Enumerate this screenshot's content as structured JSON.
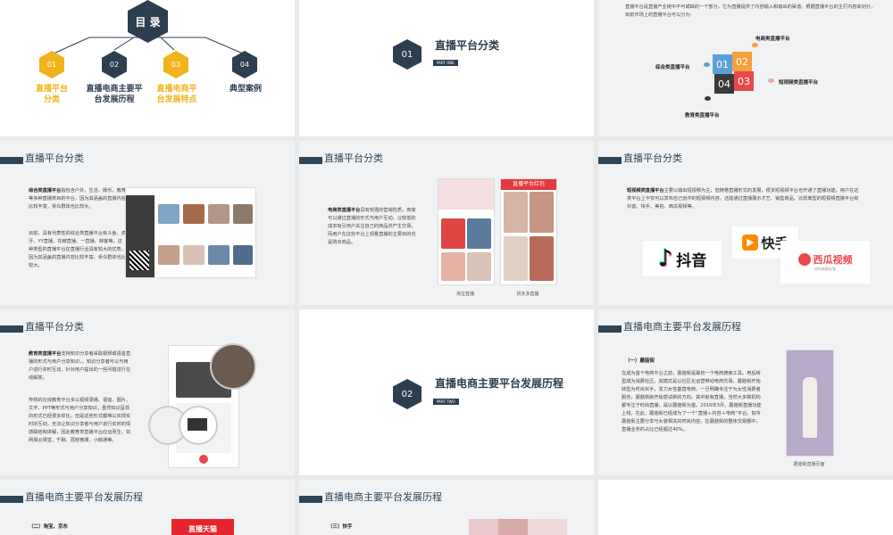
{
  "slide1": {
    "title": "目 录",
    "items": [
      {
        "num": "01",
        "label": "直播平台分类"
      },
      {
        "num": "02",
        "label": "直播电商主要平台发展历程"
      },
      {
        "num": "03",
        "label": "直播电商平台发展特点"
      },
      {
        "num": "04",
        "label": "典型案例"
      }
    ]
  },
  "slide2": {
    "num": "01",
    "title": "直播平台分类",
    "tag": "PART ONE"
  },
  "slide3": {
    "intro": "直播平台是直播产业链中不可或缺的一个部分，它为直播提供了内容输入和输出的渠道。根据直播平台的主打内容来划分，目前市场上的直播平台可以分为:",
    "labels": {
      "ecommerce": "电商类直播平台",
      "comprehensive": "综合类直播平台",
      "short": "短视频类直播平台",
      "education": "教育类直播平台"
    },
    "nums": [
      "01",
      "02",
      "03",
      "04"
    ]
  },
  "slide4": {
    "header": "直播平台分类",
    "p1_bold": "综合类直播平台",
    "p1": "指包含户外、生活、娱乐、教育等多种直播类目的平台，因为其涵盖的直播内容比较丰富，受众群体也比较大。",
    "p2": "目前，具有代表性的综合类直播平台有斗鱼、虎牙、YY直播、花椒直播、一直播、映客等。这种类型的直播平台在直播行业具有较大的优势，因为其涵盖的直播内容比较丰富，受众群体也比较大。"
  },
  "slide5": {
    "header": "直播平台分类",
    "p_bold": "电商类直播平台",
    "p": "具有较强的营销性质，商家可以通过直播的形式与用户互动，以较低的成本吸引用户关注自己的商品并产生交易，而用户在这些平台上观看直播的主要目的也是购买商品。",
    "cap1": "淘宝直播",
    "cap2": "拼多多直播",
    "banner": "直播平台红包"
  },
  "slide6": {
    "header": "直播平台分类",
    "p_bold": "短视频类直播平台",
    "p": "主要以输出短视频为主，但随着直播形式的发展，很多短视频平台也开通了直播功能，用户在这类平台上不仅可以发布自己创作的短视频内容，还能通过直播展示才艺、销售商品。比较典型的短视频直播平台有抖音、快手、美拍、西瓜视频等。",
    "logos": {
      "douyin": "抖音",
      "kuaishou": "快手",
      "xigua": "西瓜视频",
      "xigua_sub": "给你新鲜好看"
    }
  },
  "slide7": {
    "header": "直播平台分类",
    "p1_bold": "教育类直播平台",
    "p1": "支持知识分享者采取视频或语音直播的形式与用户分享知识，，知识分享者可以与用户进行实时互动，针对用户提出的一些问题进行在线解答。",
    "p2": "传统的在线教育平台多以视频录播、语音、图片、文字、PPT等形式与用户分享知识，虽然知识呈现的形式已经很多样化，但是这些形式都难以实现实时的互动，无法让知识分享者与用户进行实时的情感联结和讲解，因此教育类直播平台应运而生，如网易云课堂、千聊、荔枝微课、小鹅通等。"
  },
  "slide8": {
    "num": "02",
    "title": "直播电商主要平台发展历程",
    "tag": "PART TWO"
  },
  "slide9": {
    "header": "直播电商主要平台发展历程",
    "sub": "（一）蘑菇街",
    "p": "在成为首个电商平台之前，蘑菇街是最初一个电商搜索工具，用后转型成为消费社区，其模式是以社区化运营带动电商交易。蘑菇街开始转型为时尚买手，发力女性垂直电商，一旦明确专注于为女性消费者服务，蘑菇街就开始尝试新的方向。其中就有直播，当然大多数机构都专注于时尚直播，是以蘑菇街为首。2016年3月，蘑菇街直播功能上线，在此，蘑菇街已经成为了一个“直播＋内容＋电商”平台。如今蘑菇街主要分享与女装相关的时尚内容。在蘑菇街的整体交易额中，直播业务的占比已经超过40%。",
    "cap": "蘑菇街直播页面"
  },
  "slide10": {
    "header": "直播电商主要平台发展历程",
    "sub": "（二）淘宝、京东",
    "banner": "直播天猫"
  },
  "slide11": {
    "header": "直播电商主要平台发展历程",
    "sub": "（三）快手"
  },
  "colors": {
    "navy": "#2c3e50",
    "gold": "#f2b21b",
    "blue": "#5aa0d8",
    "orange": "#f5a03d",
    "red": "#e8494b",
    "dark": "#3a3a3a"
  }
}
